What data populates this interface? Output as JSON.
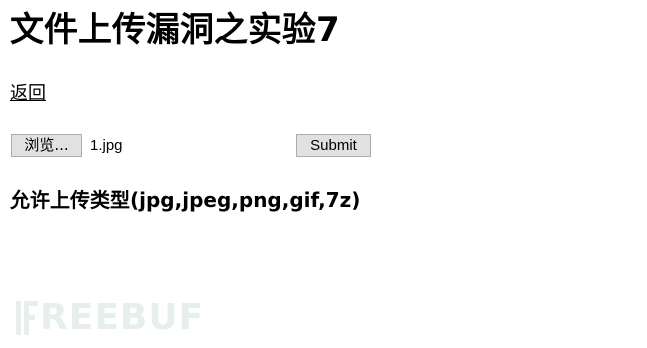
{
  "page": {
    "title": "文件上传漏洞之实验7",
    "back_link": "返回"
  },
  "form": {
    "browse_label": "浏览...",
    "file_name": "1.jpg",
    "submit_label": "Submit"
  },
  "allowed_types": "允许上传类型(jpg,jpeg,png,gif,7z)",
  "watermark": {
    "text": "REEBUF",
    "icon": "freebuf-logo-icon",
    "color": "#8fb8a8"
  }
}
